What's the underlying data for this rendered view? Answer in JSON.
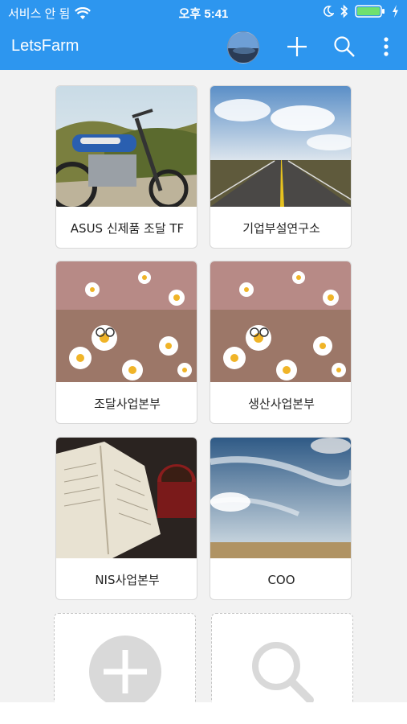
{
  "status_bar": {
    "carrier": "서비스 안 됨",
    "time": "오후 5:41",
    "icons": [
      "wifi-icon",
      "moon-icon",
      "bluetooth-icon",
      "battery-icon",
      "charging-icon"
    ]
  },
  "app_bar": {
    "title": "LetsFarm",
    "actions": [
      "avatar",
      "add-icon",
      "search-icon",
      "more-vertical-icon"
    ]
  },
  "cards": [
    {
      "label": "ASUS 신제품 조달 TF",
      "image": "motorcycle"
    },
    {
      "label": "기업부설연구소",
      "image": "road"
    },
    {
      "label": "조달사업본부",
      "image": "daisies"
    },
    {
      "label": "생산사업본부",
      "image": "daisies"
    },
    {
      "label": "NIS사업본부",
      "image": "book-and-coffee"
    },
    {
      "label": "COO",
      "image": "sky"
    }
  ],
  "actions": [
    {
      "name": "add-group",
      "icon": "plus-circle-icon"
    },
    {
      "name": "search-group",
      "icon": "search-icon"
    }
  ],
  "colors": {
    "primary": "#2d96ef",
    "background": "#f2f2f2",
    "card": "#ffffff",
    "placeholder_icon": "#d9d9d9"
  }
}
